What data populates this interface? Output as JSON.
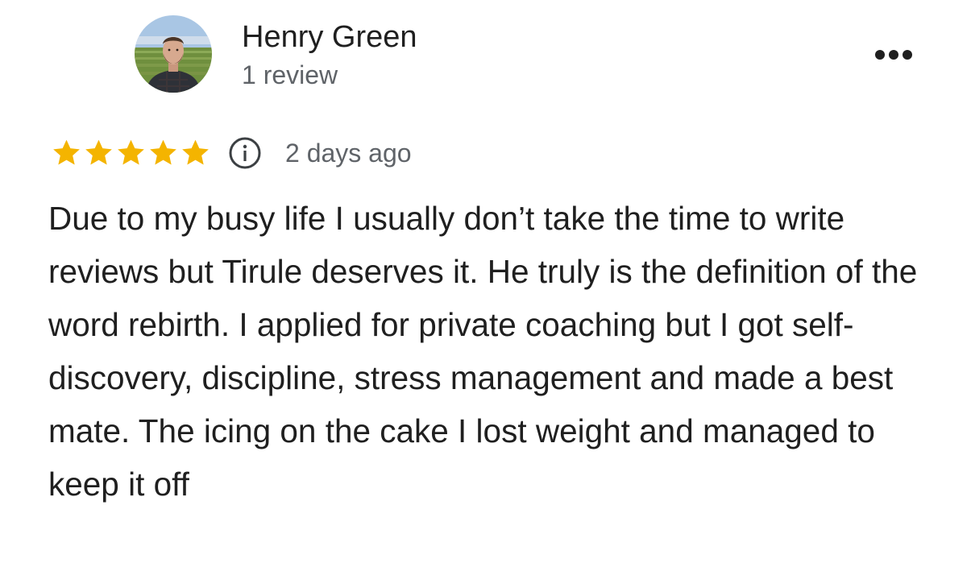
{
  "reviewer": {
    "name": "Henry Green",
    "review_count": "1 review",
    "avatar": "profile-photo"
  },
  "menu": {
    "icon": "more-horizontal-icon"
  },
  "rating": {
    "stars": 5,
    "max_stars": 5,
    "star_color": "#f4b400",
    "info_icon": "info-icon",
    "date": "2 days ago"
  },
  "review": {
    "text": "Due to my busy life I usually don’t take the time to write reviews but Tirule deserves it. He truly is the definition of the word rebirth. I applied for private coaching but I got self-discovery, discipline, stress management and made a best mate. The icing on the cake I lost weight and managed to keep it off"
  }
}
